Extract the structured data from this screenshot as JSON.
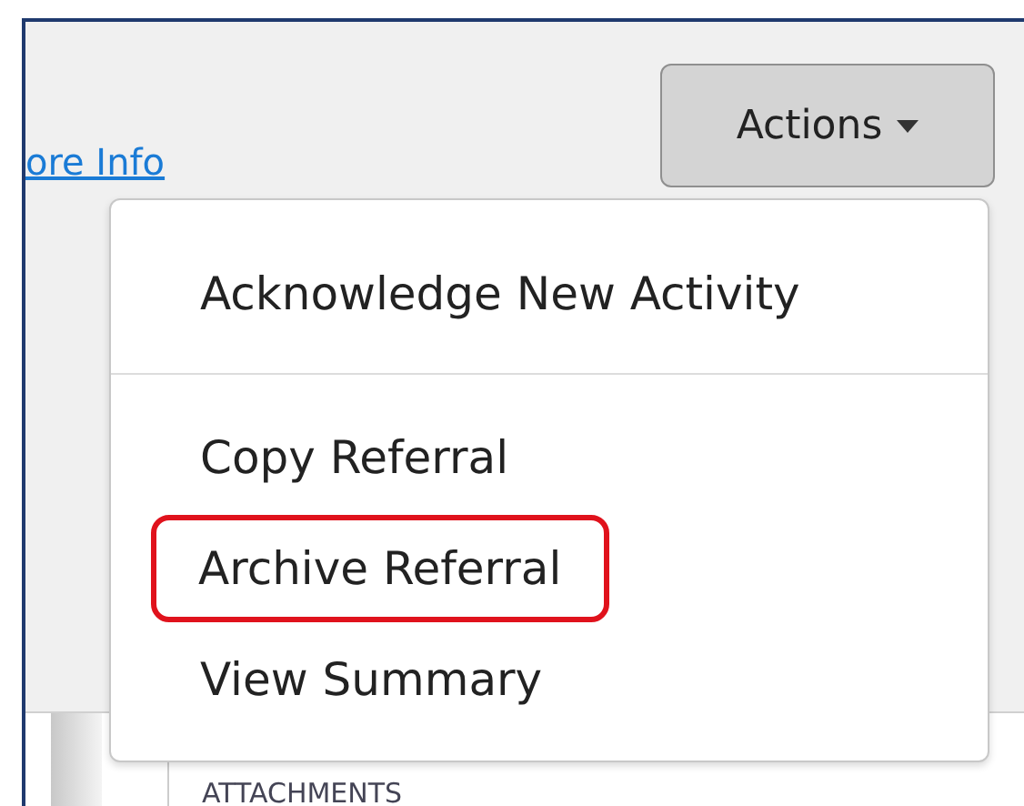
{
  "link": {
    "label": "ore Info"
  },
  "actions_button": {
    "label": "Actions"
  },
  "menu": {
    "groups": [
      [
        {
          "label": "Acknowledge New Activity",
          "highlighted": false
        }
      ],
      [
        {
          "label": "Copy Referral",
          "highlighted": false
        },
        {
          "label": "Archive Referral",
          "highlighted": true
        },
        {
          "label": "View Summary",
          "highlighted": false
        }
      ]
    ]
  },
  "section": {
    "heading": "ATTACHMENTS"
  }
}
